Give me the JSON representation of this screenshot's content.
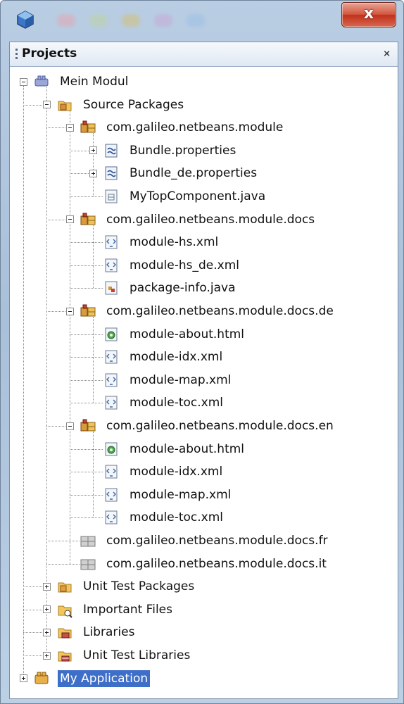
{
  "window": {
    "close_label": "x"
  },
  "panel": {
    "title": "Projects",
    "close_label": "⨯"
  },
  "tree": [
    {
      "label": "Mein Modul",
      "icon": "module-icon",
      "depth": 0,
      "state": "open"
    },
    {
      "label": "Source Packages",
      "icon": "source-packages-icon",
      "depth": 1,
      "state": "open"
    },
    {
      "label": "com.galileo.netbeans.module",
      "icon": "package-icon",
      "depth": 2,
      "state": "open"
    },
    {
      "label": "Bundle.properties",
      "icon": "properties-file-icon",
      "depth": 3,
      "state": "closed"
    },
    {
      "label": "Bundle_de.properties",
      "icon": "properties-file-icon",
      "depth": 3,
      "state": "closed"
    },
    {
      "label": "MyTopComponent.java",
      "icon": "java-file-icon",
      "depth": 3,
      "state": "leaf"
    },
    {
      "label": "com.galileo.netbeans.module.docs",
      "icon": "package-icon",
      "depth": 2,
      "state": "open"
    },
    {
      "label": "module-hs.xml",
      "icon": "xml-file-icon",
      "depth": 3,
      "state": "leaf"
    },
    {
      "label": "module-hs_de.xml",
      "icon": "xml-file-icon",
      "depth": 3,
      "state": "leaf"
    },
    {
      "label": "package-info.java",
      "icon": "package-info-icon",
      "depth": 3,
      "state": "leaf"
    },
    {
      "label": "com.galileo.netbeans.module.docs.de",
      "icon": "package-icon",
      "depth": 2,
      "state": "open"
    },
    {
      "label": "module-about.html",
      "icon": "html-file-icon",
      "depth": 3,
      "state": "leaf"
    },
    {
      "label": "module-idx.xml",
      "icon": "xml-file-icon",
      "depth": 3,
      "state": "leaf"
    },
    {
      "label": "module-map.xml",
      "icon": "xml-file-icon",
      "depth": 3,
      "state": "leaf"
    },
    {
      "label": "module-toc.xml",
      "icon": "xml-file-icon",
      "depth": 3,
      "state": "leaf"
    },
    {
      "label": "com.galileo.netbeans.module.docs.en",
      "icon": "package-icon",
      "depth": 2,
      "state": "open"
    },
    {
      "label": "module-about.html",
      "icon": "html-file-icon",
      "depth": 3,
      "state": "leaf"
    },
    {
      "label": "module-idx.xml",
      "icon": "xml-file-icon",
      "depth": 3,
      "state": "leaf"
    },
    {
      "label": "module-map.xml",
      "icon": "xml-file-icon",
      "depth": 3,
      "state": "leaf"
    },
    {
      "label": "module-toc.xml",
      "icon": "xml-file-icon",
      "depth": 3,
      "state": "leaf"
    },
    {
      "label": "com.galileo.netbeans.module.docs.fr",
      "icon": "empty-package-icon",
      "depth": 2,
      "state": "leaf"
    },
    {
      "label": "com.galileo.netbeans.module.docs.it",
      "icon": "empty-package-icon",
      "depth": 2,
      "state": "leaf"
    },
    {
      "label": "Unit Test Packages",
      "icon": "test-packages-icon",
      "depth": 1,
      "state": "closed"
    },
    {
      "label": "Important Files",
      "icon": "important-files-icon",
      "depth": 1,
      "state": "closed"
    },
    {
      "label": "Libraries",
      "icon": "libraries-icon",
      "depth": 1,
      "state": "closed"
    },
    {
      "label": "Unit Test Libraries",
      "icon": "test-libraries-icon",
      "depth": 1,
      "state": "closed"
    },
    {
      "label": "My Application",
      "icon": "application-suite-icon",
      "depth": 0,
      "state": "closed",
      "selected": true
    }
  ],
  "colors": {
    "selection": "#3e6fc8",
    "title_gradient": "#b9cde3",
    "close_button": "#c0321c"
  }
}
